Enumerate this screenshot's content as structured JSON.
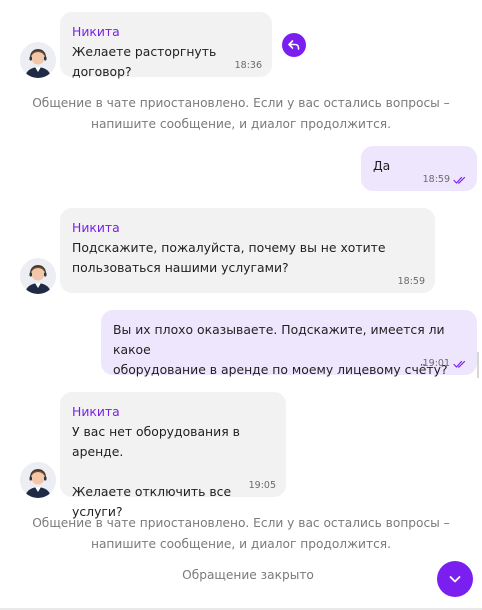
{
  "colors": {
    "accent": "#7a1ff0",
    "incoming_bubble": "#f2f2f3",
    "outgoing_bubble": "#eee6fd",
    "sender_name": "#7a20e6",
    "system_text": "#7a7a7a"
  },
  "messages": [
    {
      "sender": "Никита",
      "text": "Желаете расторгнуть договор?",
      "time": "18:36"
    },
    {
      "text": "Да",
      "time": "18:59"
    },
    {
      "sender": "Никита",
      "text": "Подскажите, пожалуйста, почему вы не хотите\nпользоваться нашими услугами?",
      "time": "18:59"
    },
    {
      "text": "Вы их плохо оказываете. Подскажите, имеется ли какое\nоборудование в аренде по моему лицевому счёту?",
      "time": "19:01"
    },
    {
      "sender": "Никита",
      "text": "У вас нет оборудования в аренде.\n\nЖелаете отключить все услуги?",
      "time": "19:05"
    }
  ],
  "system_notice": "Общение в чате приостановлено. Если у вас остались вопросы –\nнапишите сообщение, и диалог продолжится.",
  "closed_label": "Обращение закрыто",
  "icons": {
    "reply": "reply-arrow-icon",
    "read": "double-check-icon",
    "scroll_down": "chevron-down-icon",
    "avatar": "operator-avatar"
  }
}
